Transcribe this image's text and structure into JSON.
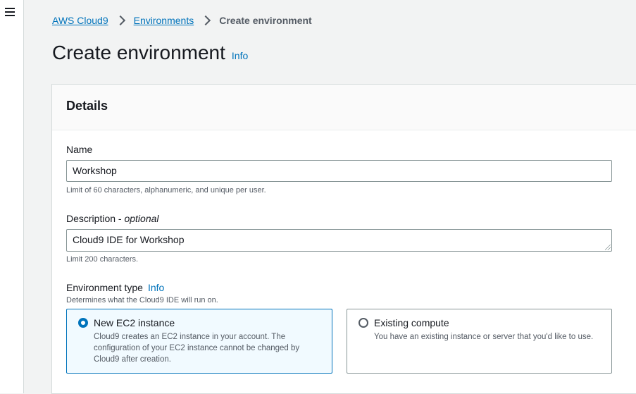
{
  "breadcrumb": {
    "items": [
      "AWS Cloud9",
      "Environments"
    ],
    "current": "Create environment"
  },
  "page": {
    "title": "Create environment",
    "info": "Info"
  },
  "details": {
    "heading": "Details",
    "name": {
      "label": "Name",
      "value": "Workshop",
      "hint": "Limit of 60 characters, alphanumeric, and unique per user."
    },
    "description": {
      "label": "Description - ",
      "label_optional": "optional",
      "value": "Cloud9 IDE for Workshop",
      "hint": "Limit 200 characters."
    },
    "environment_type": {
      "label": "Environment type",
      "info": "Info",
      "hint": "Determines what the Cloud9 IDE will run on.",
      "options": [
        {
          "title": "New EC2 instance",
          "description": "Cloud9 creates an EC2 instance in your account. The configuration of your EC2 instance cannot be changed by Cloud9 after creation.",
          "selected": true
        },
        {
          "title": "Existing compute",
          "description": "You have an existing instance or server that you'd like to use.",
          "selected": false
        }
      ]
    }
  },
  "colors": {
    "link": "#0073bb",
    "selected_bg": "#f1faff",
    "border": "#879596"
  },
  "icons": {
    "menu": "hamburger-menu-icon",
    "separator": "chevron-right-icon"
  }
}
